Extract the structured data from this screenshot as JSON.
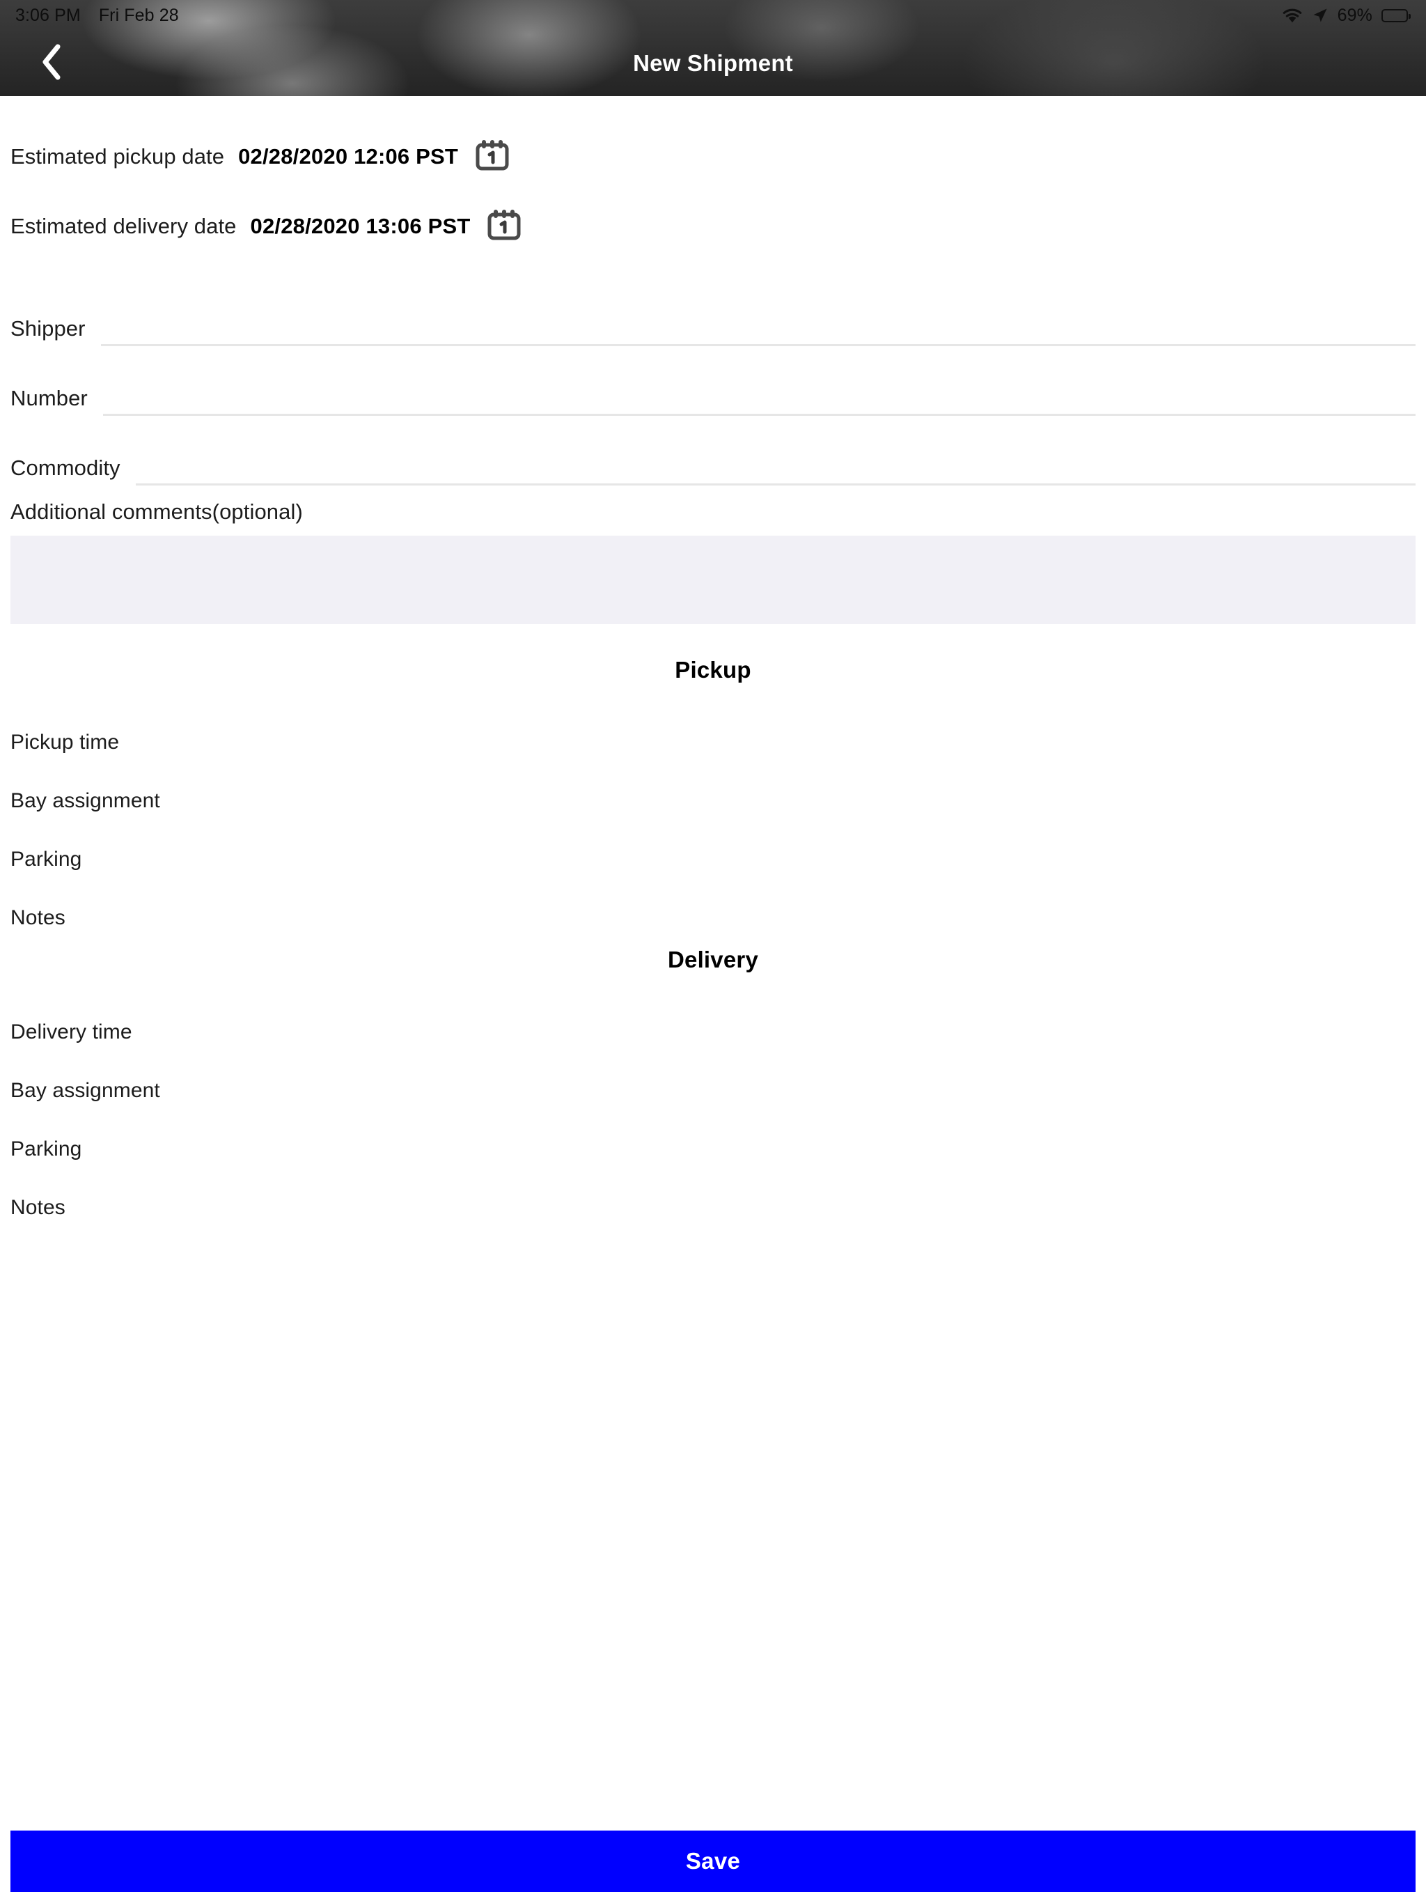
{
  "status_bar": {
    "time": "3:06 PM",
    "date": "Fri Feb 28",
    "wifi_icon": "wifi-icon",
    "location_icon": "location-arrow-icon",
    "battery_percent": "69%",
    "battery_icon": "battery-icon",
    "battery_level": 69,
    "text_color": "#0d0d0d"
  },
  "nav_bar": {
    "back_icon": "chevron-left-icon",
    "title": "New Shipment",
    "title_color": "#ffffff",
    "background_color": "#2e2e2e"
  },
  "form": {
    "pickup_date": {
      "label": "Estimated pickup date",
      "value": "02/28/2020 12:06 PST",
      "calendar_icon": "calendar-icon",
      "calendar_day": "1"
    },
    "delivery_date": {
      "label": "Estimated delivery date",
      "value": "02/28/2020 13:06 PST",
      "calendar_icon": "calendar-icon",
      "calendar_day": "1"
    },
    "fields": [
      {
        "label": "Shipper",
        "value": "",
        "placeholder": ""
      },
      {
        "label": "Number",
        "value": "",
        "placeholder": ""
      },
      {
        "label": "Commodity",
        "value": "",
        "placeholder": ""
      }
    ],
    "comments": {
      "label": "Additional comments(optional)",
      "value": "",
      "placeholder": "",
      "background_color": "#f1f0f6"
    }
  },
  "pickup_section": {
    "title": "Pickup",
    "rows": [
      {
        "label": "Pickup time",
        "value": "",
        "placeholder": ""
      },
      {
        "label": "Bay assignment",
        "value": "",
        "placeholder": ""
      },
      {
        "label": "Parking",
        "value": "",
        "placeholder": ""
      },
      {
        "label": "Notes",
        "value": "",
        "placeholder": ""
      }
    ]
  },
  "delivery_section": {
    "title": "Delivery",
    "rows": [
      {
        "label": "Delivery time",
        "value": "",
        "placeholder": ""
      },
      {
        "label": "Bay assignment",
        "value": "",
        "placeholder": ""
      },
      {
        "label": "Parking",
        "value": "",
        "placeholder": ""
      },
      {
        "label": "Notes",
        "value": "",
        "placeholder": ""
      }
    ]
  },
  "footer": {
    "save_label": "Save",
    "save_color": "#0000ff",
    "save_text_color": "#ffffff"
  }
}
